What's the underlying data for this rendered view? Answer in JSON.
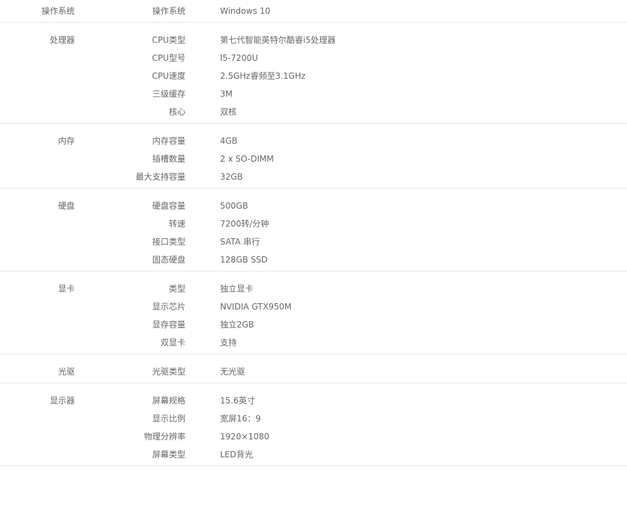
{
  "specs": [
    {
      "title": "操作系统",
      "rows": [
        {
          "key": "操作系统",
          "value": "Windows 10"
        }
      ]
    },
    {
      "title": "处理器",
      "rows": [
        {
          "key": "CPU类型",
          "value": "第七代智能英特尔酷睿i5处理器"
        },
        {
          "key": "CPU型号",
          "value": "I5-7200U"
        },
        {
          "key": "CPU速度",
          "value": "2.5GHz睿频至3.1GHz"
        },
        {
          "key": "三级缓存",
          "value": "3M"
        },
        {
          "key": "核心",
          "value": "双核"
        }
      ]
    },
    {
      "title": "内存",
      "rows": [
        {
          "key": "内存容量",
          "value": "4GB"
        },
        {
          "key": "插槽数量",
          "value": "2 x SO-DIMM"
        },
        {
          "key": "最大支持容量",
          "value": "32GB"
        }
      ]
    },
    {
      "title": "硬盘",
      "rows": [
        {
          "key": "硬盘容量",
          "value": "500GB"
        },
        {
          "key": "转速",
          "value": "7200转/分钟"
        },
        {
          "key": "接口类型",
          "value": "SATA 串行"
        },
        {
          "key": "固态硬盘",
          "value": "128GB SSD"
        }
      ]
    },
    {
      "title": "显卡",
      "rows": [
        {
          "key": "类型",
          "value": "独立显卡"
        },
        {
          "key": "显示芯片",
          "value": "NVIDIA GTX950M"
        },
        {
          "key": "显存容量",
          "value": "独立2GB"
        },
        {
          "key": "双显卡",
          "value": "支持"
        }
      ]
    },
    {
      "title": "光驱",
      "rows": [
        {
          "key": "光驱类型",
          "value": "无光驱"
        }
      ]
    },
    {
      "title": "显示器",
      "rows": [
        {
          "key": "屏幕规格",
          "value": "15.6英寸"
        },
        {
          "key": "显示比例",
          "value": "宽屏16：9"
        },
        {
          "key": "物理分辨率",
          "value": "1920×1080"
        },
        {
          "key": "屏幕类型",
          "value": "LED背光"
        }
      ]
    }
  ]
}
